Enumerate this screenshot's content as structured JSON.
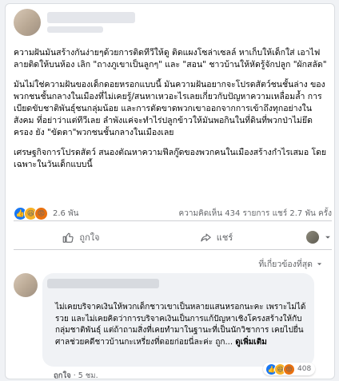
{
  "post": {
    "paragraphs": [
      "ความฝันมันสร้างกันง่ายๆด้วยการติดทีวีให้ดู ติดแผงโซล่าเซลล์ หาเก็บให้เด็กใส่ เอาไฟลายติดให้บนห้อง เลิก \"ถางภูเขาเป็นลูกๆ\" และ \"สอน\" ชาวบ้านให้หัดรู้จักปลูก \"ผักสลัด\"",
      "มันไม่ใช่ความฝันของเด็กดอยหรอกแบบนี้ มันความฝันอยากจะโปรดสัตว์ชนชั้นล่าง ของพวกชนชั้นกลางในเมืองที่ไม่เคยรู้/สนหาเหวอะไรเลยเกี่ยวกับปัญหาความเหลื่อมล้ำ การเบียดขับชาติพันธุ์ชนกลุ่มน้อย และการตัดขาดพวกเขาออกจากการเข้าถึงทุกอย่างในสังคม ที่อย่าว่าแต่ทีวีเลย ลำพังแค่จะทำไร่ปลูกข้าวให้มันพอกินในที่ดินที่พวกป่าไม่ยึดครอง ยัง \"ขัดตา\"พวกชนชั้นกลางในเมืองเลย",
      "เศรษฐกิจการโปรดสัตว์ สนองตัณหาความฟีลกู๊ดของพวกคนในเมืองสร้างกำไรเสมอ โดยเฉพาะในวันเด็กแบบนี้"
    ],
    "reaction_count": "2.6 พัน",
    "comments_shares": "ความคิดเห็น 434 รายการ   แชร์ 2.7 พัน ครั้ง",
    "like_label": "ถูกใจ",
    "share_label": "แชร์"
  },
  "comments": {
    "sort_label": "ที่เกี่ยวข้องที่สุด",
    "first": {
      "text": "ไม่เคยบริจาคเงินให้พวกเด็กชาวเขาเป็นหลายแสนหรอกนะคะ เพราะไม่ได้รวย และไม่เคยคิดว่าการบริจาคเงินเป็นการแก้ปัญหาเชิงโครงสร้างให้กับกลุ่มชาติพันธุ์ แต่ถ้าถามสิ่งที่เคยทำมาในฐานะที่เป็นนักวิชาการ เคยไปยื่นศาลช่วยคดีชาวบ้านกะเหรี่ยงที่ดอยก่อยนี่ละค่ะ ถูก...",
      "see_more": "ดูเพิ่มเติม",
      "reaction_count": "408",
      "like_label": "ถูกใจ",
      "time": "5 ชม."
    }
  },
  "colors": {
    "accent": "#1877f2",
    "muted": "#65676b"
  },
  "icons": [
    "like-icon",
    "share-icon",
    "chevron-down-icon",
    "laugh-icon",
    "angry-icon"
  ]
}
